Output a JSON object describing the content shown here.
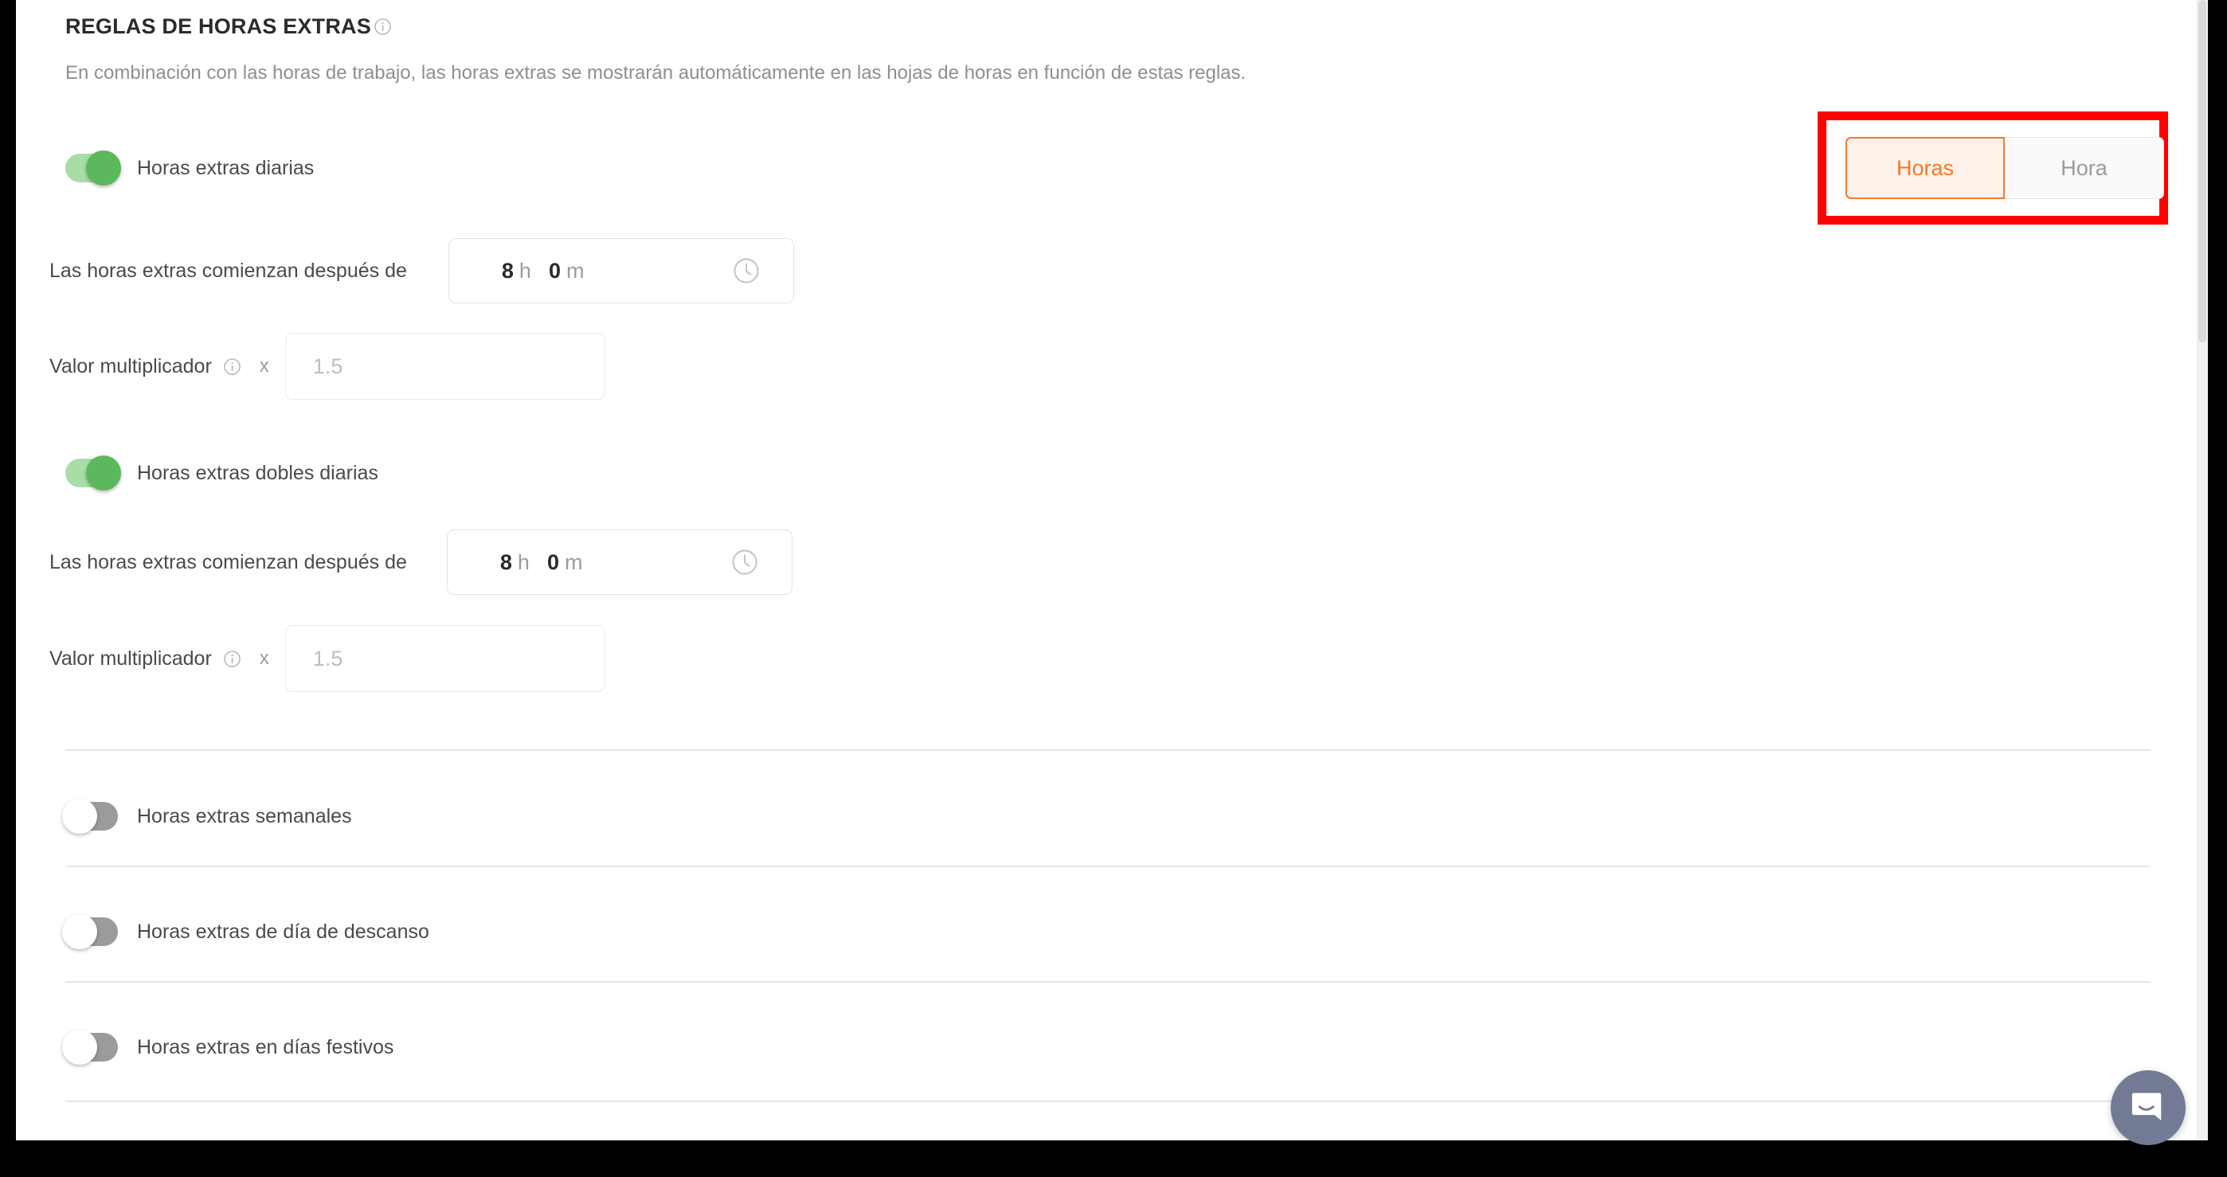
{
  "section": {
    "title": "REGLAS DE HORAS EXTRAS",
    "title_info_icon": "info-icon",
    "description": "En combinación con las horas de trabajo, las horas extras se mostrarán automáticamente en las hojas de horas en función de estas reglas."
  },
  "unit_toggle": {
    "options": [
      {
        "label": "Horas",
        "active": true
      },
      {
        "label": "Hora",
        "active": false
      }
    ],
    "selected": "Horas",
    "highlight_color": "#ff0000",
    "active_color": "#f2792a",
    "active_bg": "#fdf2e9",
    "inactive_color": "#9a9a9a"
  },
  "rules": [
    {
      "toggle_label": "Horas extras diarias",
      "toggle_state": "on",
      "start_after_label": "Las horas extras comienzan después de",
      "hours_value": "8",
      "hours_unit": "h",
      "minutes_value": "0",
      "minutes_unit": "m",
      "clock_icon": "clock-icon",
      "multiplier_label": "Valor multiplicador",
      "multiplier_info_icon": "info-icon",
      "multiply_sign": "x",
      "multiplier_placeholder": "1.5",
      "multiplier_value": ""
    },
    {
      "toggle_label": "Horas extras dobles diarias",
      "toggle_state": "on",
      "start_after_label": "Las horas extras comienzan después de",
      "hours_value": "8",
      "hours_unit": "h",
      "minutes_value": "0",
      "minutes_unit": "m",
      "clock_icon": "clock-icon",
      "multiplier_label": "Valor multiplicador",
      "multiplier_info_icon": "info-icon",
      "multiply_sign": "x",
      "multiplier_placeholder": "1.5",
      "multiplier_value": ""
    }
  ],
  "simple_toggles": [
    {
      "label": "Horas extras semanales",
      "state": "off"
    },
    {
      "label": "Horas extras de día de descanso",
      "state": "off"
    },
    {
      "label": "Horas extras en días festivos",
      "state": "off"
    }
  ],
  "chat": {
    "icon": "chat-bubble-icon",
    "color": "#737a94"
  },
  "colors": {
    "toggle_on_track": "#a8dda8",
    "toggle_on_knob": "#5cb85c",
    "toggle_off_track": "#9b9b9e",
    "divider": "#e6e6e6",
    "text_primary": "#2b2b2b",
    "text_secondary": "#4a4a4a",
    "text_muted": "#8f8f8f"
  }
}
